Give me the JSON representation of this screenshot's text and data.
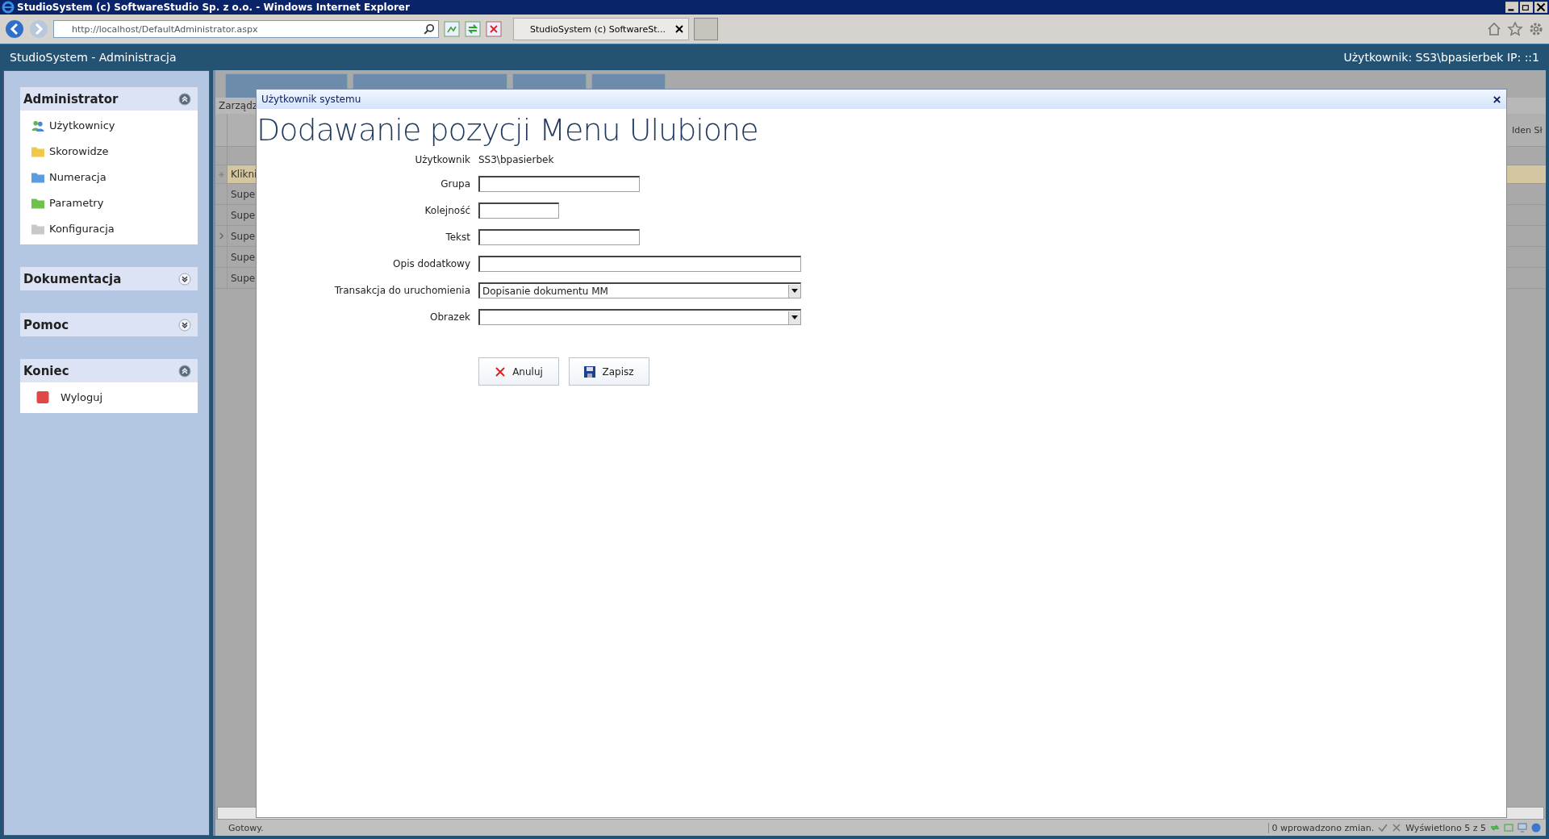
{
  "browser": {
    "title": "StudioSystem (c) SoftwareStudio Sp. z o.o. - Windows Internet Explorer",
    "address": "http://localhost/DefaultAdministrator.aspx",
    "tab": "StudioSystem (c) SoftwareSt..."
  },
  "app": {
    "title": "StudioSystem - Administracja",
    "user": "Użytkownik: SS3\\bpasierbek IP: ::1"
  },
  "sidebar": [
    {
      "title": "Administrator",
      "expanded": true,
      "items": [
        {
          "label": "Użytkownicy",
          "kind": "users"
        },
        {
          "label": "Skorowidze",
          "kind": "folder",
          "color": "#f2c84b"
        },
        {
          "label": "Numeracja",
          "kind": "folder",
          "color": "#5b9be0"
        },
        {
          "label": "Parametry",
          "kind": "folder",
          "color": "#6cc24a"
        },
        {
          "label": "Konfiguracja",
          "kind": "folder",
          "color": "#c8c8c8"
        }
      ]
    },
    {
      "title": "Dokumentacja",
      "expanded": false
    },
    {
      "title": "Pomoc",
      "expanded": false
    },
    {
      "title": "Koniec",
      "expanded": true,
      "items": [
        {
          "label": "Wyloguj",
          "kind": "stop",
          "color": "#e04848"
        }
      ]
    }
  ],
  "grid": {
    "section": "Zarządz",
    "header_right": "Iden Sł",
    "new_row": "Klikni",
    "rows": [
      {
        "cell": "Supe",
        "current": false
      },
      {
        "cell": "Supe",
        "current": false
      },
      {
        "cell": "Supe",
        "current": true
      },
      {
        "cell": "Supe",
        "current": false
      },
      {
        "cell": "Supe",
        "current": false
      }
    ]
  },
  "dialog": {
    "title": "Użytkownik systemu",
    "heading": "Dodawanie pozycji Menu Ulubione",
    "fields": [
      {
        "label": "Użytkownik",
        "kind": "text",
        "value": "SS3\\bpasierbek"
      },
      {
        "label": "Grupa",
        "kind": "input"
      },
      {
        "label": "Kolejność",
        "kind": "input"
      },
      {
        "label": "Tekst",
        "kind": "input"
      },
      {
        "label": "Opis dodatkowy",
        "kind": "input"
      },
      {
        "label": "Transakcja do uruchomienia",
        "kind": "select",
        "value": "Dopisanie dokumentu MM"
      },
      {
        "label": "Obrazek",
        "kind": "select"
      }
    ],
    "buttons": [
      {
        "label": "Anuluj",
        "kind": "cancel"
      },
      {
        "label": "Zapisz",
        "kind": "save"
      }
    ]
  },
  "status": {
    "text": "Gotowy.",
    "changes": "0 wprowadzono zmian.",
    "count": "Wyświetlono 5 z 5"
  }
}
